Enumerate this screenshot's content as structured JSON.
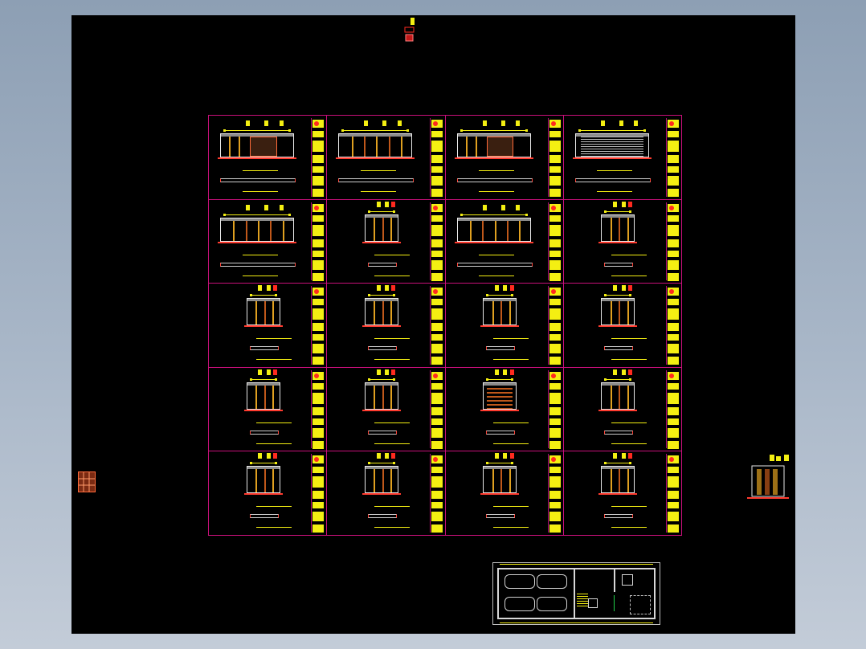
{
  "app": {
    "background_color": "#8d9fb4",
    "canvas_color": "#000000"
  },
  "colors": {
    "frame_border": "#c8107a",
    "title_block": "#f4ef12",
    "accent_red": "#ff2a1f",
    "line_white": "#e8e8e8",
    "wood": "#e0a020"
  },
  "north_marker": {
    "icon": "north-arrow-icon"
  },
  "sheet_grid": {
    "rows": 5,
    "cols": 4,
    "sheets": [
      {
        "row": 0,
        "col": 0,
        "label": "",
        "variant": "wide-dark"
      },
      {
        "row": 0,
        "col": 1,
        "label": "",
        "variant": "wide-plain"
      },
      {
        "row": 0,
        "col": 2,
        "label": "",
        "variant": "wide-dark"
      },
      {
        "row": 0,
        "col": 3,
        "label": "",
        "variant": "striped"
      },
      {
        "row": 1,
        "col": 0,
        "label": "",
        "variant": "wide-panels"
      },
      {
        "row": 1,
        "col": 1,
        "label": "",
        "variant": "panels"
      },
      {
        "row": 1,
        "col": 2,
        "label": "",
        "variant": "wide-panels"
      },
      {
        "row": 1,
        "col": 3,
        "label": "",
        "variant": "panels"
      },
      {
        "row": 2,
        "col": 0,
        "label": "",
        "variant": "door"
      },
      {
        "row": 2,
        "col": 1,
        "label": "",
        "variant": "door"
      },
      {
        "row": 2,
        "col": 2,
        "label": "",
        "variant": "door"
      },
      {
        "row": 2,
        "col": 3,
        "label": "",
        "variant": "door"
      },
      {
        "row": 3,
        "col": 0,
        "label": "",
        "variant": "door"
      },
      {
        "row": 3,
        "col": 1,
        "label": "",
        "variant": "door"
      },
      {
        "row": 3,
        "col": 2,
        "label": "",
        "variant": "shelves"
      },
      {
        "row": 3,
        "col": 3,
        "label": "",
        "variant": "door"
      },
      {
        "row": 4,
        "col": 0,
        "label": "",
        "variant": "door"
      },
      {
        "row": 4,
        "col": 1,
        "label": "",
        "variant": "door"
      },
      {
        "row": 4,
        "col": 2,
        "label": "",
        "variant": "door"
      },
      {
        "row": 4,
        "col": 3,
        "label": "",
        "variant": "door"
      }
    ]
  },
  "side_elements": {
    "left_detail": {
      "icon": "detail-thumbnail-icon"
    },
    "right_detail": {
      "icon": "detail-thumbnail-icon"
    }
  },
  "floor_plan": {
    "icon": "floor-plan-icon"
  }
}
